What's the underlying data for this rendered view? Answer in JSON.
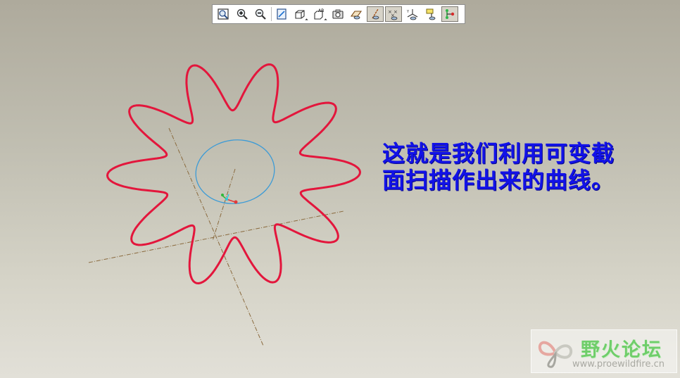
{
  "toolbar": {
    "buttons": [
      {
        "name": "refit-icon",
        "active": false
      },
      {
        "name": "zoom-in-icon",
        "active": false
      },
      {
        "name": "zoom-out-icon",
        "active": false
      },
      {
        "name": "repaint-icon",
        "active": false
      },
      {
        "name": "display-style-icon",
        "active": false
      },
      {
        "name": "saved-view-icon",
        "active": false
      },
      {
        "name": "view-manager-icon",
        "active": false
      },
      {
        "name": "datum-plane-display-icon",
        "active": false
      },
      {
        "name": "datum-axis-display-icon",
        "active": true
      },
      {
        "name": "datum-point-display-icon",
        "active": true
      },
      {
        "name": "csys-display-icon",
        "active": false
      },
      {
        "name": "annotation-display-icon",
        "active": false
      },
      {
        "name": "spin-center-icon",
        "active": true
      }
    ]
  },
  "annotation": {
    "line1": "这就是我们利用可变截",
    "line2": "面扫描作出来的曲线。",
    "color": "#1212e8"
  },
  "model": {
    "curve_color": "#e3163c",
    "circle_color": "#3d9bd6",
    "axis_color": "#8a6a3e",
    "lobes": 10
  },
  "watermark": {
    "title": "野火论坛",
    "url": "www.proewildfire.cn"
  }
}
